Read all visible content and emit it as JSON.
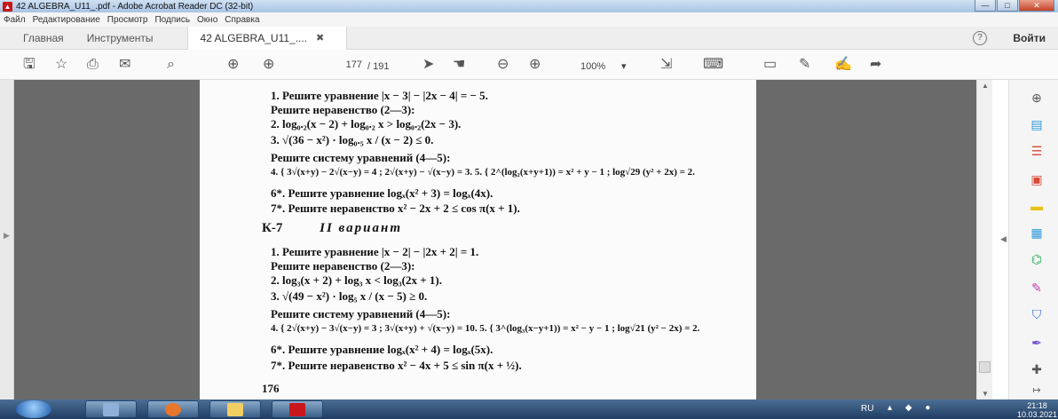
{
  "window": {
    "title": "42 ALGEBRA_U11_.pdf - Adobe Acrobat Reader DC (32-bit)",
    "minimize": "—",
    "maximize": "□",
    "close": "✕"
  },
  "menu": [
    "Файл",
    "Редактирование",
    "Просмотр",
    "Подпись",
    "Окно",
    "Справка"
  ],
  "tabs": {
    "home": "Главная",
    "tools": "Инструменты",
    "document": "42 ALGEBRA_U11_....",
    "close_glyph": "✖",
    "help": "?",
    "login": "Войти"
  },
  "toolbar": {
    "current_page": "177",
    "page_total": "/ 191",
    "zoom": "100%",
    "zoom_caret": "▾",
    "icons": [
      "save-icon",
      "bookmark-icon",
      "print-icon",
      "email-icon",
      "search-icon",
      "prev-page-icon",
      "next-page-icon",
      "select-cursor-icon",
      "hand-tool-icon",
      "zoom-out-icon",
      "zoom-in-icon",
      "fit-page-icon",
      "keyboard-icon",
      "comment-icon",
      "pen-icon",
      "sign-icon",
      "share-icon"
    ]
  },
  "document": {
    "lines_v1": [
      "1.  Решите уравнение |x − 3| − |2x − 4| = − 5.",
      "Решите неравенство (2—3):",
      "2.  log₀.₂(x − 2) + log₀.₂ x > log₀.₂(2x − 3).",
      "3.  √(36 − x²) · log₀.₅ x / (x − 2) ≤ 0.",
      "Решите систему уравнений (4—5):",
      "4.  { 3√(x+y) − 2√(x−y) = 4 ; 2√(x+y) − √(x−y) = 3.      5.  { 2^(log₂(x+y+1)) = x² + y − 1 ; log√29 (y² + 2x) = 2.",
      "6*. Решите уравнение  logₓ(x² + 3) = logₓ(4x).",
      "7*. Решите неравенство  x² − 2x + 2 ≤ cos π(x + 1)."
    ],
    "heading_code": "К-7",
    "heading_variant": "II вариант",
    "lines_v2": [
      "1.  Решите уравнение |x − 2| − |2x + 2| = 1.",
      "Решите неравенство (2—3):",
      "2.  log₃(x + 2) + log₃ x < log₃(2x + 1).",
      "3.  √(49 − x²) · log₅ x / (x − 5) ≥ 0.",
      "Решите систему уравнений (4—5):",
      "4.  { 2√(x+y) − 3√(x−y) = 3 ; 3√(x+y) + √(x−y) = 10.      5.  { 3^(log₃(x−y+1)) = x² − y − 1 ; log√21 (y² − 2x) = 2.",
      "6*. Решите уравнение  logₓ(x² + 4) = logₓ(5x).",
      "7*. Решите неравенство  x² − 4x + 5 ≤ sin π(x + ½)."
    ],
    "page_number": "176"
  },
  "right_panel_icons": [
    "zoom-panel-icon",
    "export-pdf-icon",
    "organize-pages-icon",
    "create-pdf-icon",
    "comment-panel-icon",
    "scan-icon",
    "fill-sign-icon",
    "edit-icon",
    "protect-icon",
    "annotate-icon",
    "more-tools-icon",
    "expand-panel-icon"
  ],
  "taskbar": {
    "language": "RU",
    "time": "21:18",
    "date": "10.03.2021"
  },
  "colors": {
    "canvas": "#6a6a6a",
    "page": "#fbfbfb",
    "acrobat_red": "#c8161d",
    "taskbar": "#203d62"
  }
}
